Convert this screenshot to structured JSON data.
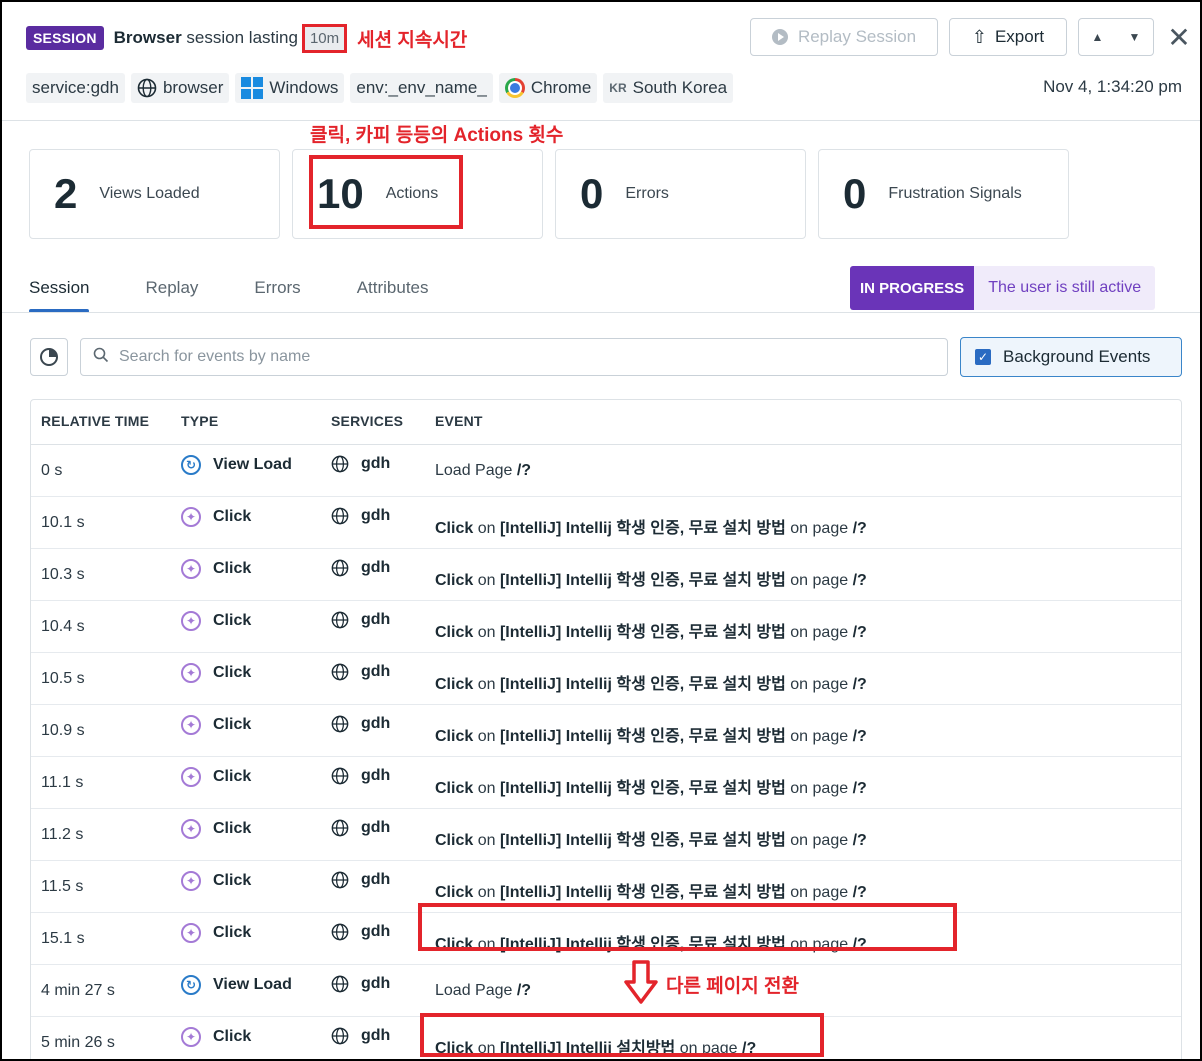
{
  "header": {
    "badge": "SESSION",
    "title_bold": "Browser",
    "title_rest": "session lasting",
    "duration": "10m",
    "annotation_duration": "세션 지속시간",
    "replay_label": "Replay Session",
    "export_label": "Export",
    "timestamp": "Nov 4, 1:34:20 pm",
    "tags": {
      "service": "service:gdh",
      "browser": "browser",
      "os": "Windows",
      "env": "env:_env_name_",
      "chrome": "Chrome",
      "country_code": "KR",
      "country": "South Korea"
    }
  },
  "summary": {
    "annotation": "클릭, 카피 등등의 Actions 횟수",
    "views": {
      "value": "2",
      "label": "Views Loaded"
    },
    "actions": {
      "value": "10",
      "label": "Actions"
    },
    "errors": {
      "value": "0",
      "label": "Errors"
    },
    "frustration": {
      "value": "0",
      "label": "Frustration Signals"
    }
  },
  "tabs": [
    "Session",
    "Replay",
    "Errors",
    "Attributes"
  ],
  "status": {
    "pill": "IN PROGRESS",
    "message": "The user is still active"
  },
  "search": {
    "placeholder": "Search for events by name"
  },
  "background_events": {
    "label": "Background Events",
    "checked": true
  },
  "table": {
    "columns": [
      "RELATIVE TIME",
      "TYPE",
      "SERVICES",
      "EVENT"
    ],
    "rows": [
      {
        "time": "0 s",
        "type": "View Load",
        "service": "gdh",
        "e1": "Load Page",
        "e2": " /?",
        "e3": "",
        "e4": ""
      },
      {
        "time": "10.1 s",
        "type": "Click",
        "service": "gdh",
        "e1": "Click",
        "e2": " on ",
        "e3": "[IntelliJ] Intellij 학생 인증, 무료 설치 방법",
        "e4": " on page /?"
      },
      {
        "time": "10.3 s",
        "type": "Click",
        "service": "gdh",
        "e1": "Click",
        "e2": " on ",
        "e3": "[IntelliJ] Intellij 학생 인증, 무료 설치 방법",
        "e4": " on page /?"
      },
      {
        "time": "10.4 s",
        "type": "Click",
        "service": "gdh",
        "e1": "Click",
        "e2": " on ",
        "e3": "[IntelliJ] Intellij 학생 인증, 무료 설치 방법",
        "e4": " on page /?"
      },
      {
        "time": "10.5 s",
        "type": "Click",
        "service": "gdh",
        "e1": "Click",
        "e2": " on ",
        "e3": "[IntelliJ] Intellij 학생 인증, 무료 설치 방법",
        "e4": " on page /?"
      },
      {
        "time": "10.9 s",
        "type": "Click",
        "service": "gdh",
        "e1": "Click",
        "e2": " on ",
        "e3": "[IntelliJ] Intellij 학생 인증, 무료 설치 방법",
        "e4": " on page /?"
      },
      {
        "time": "11.1 s",
        "type": "Click",
        "service": "gdh",
        "e1": "Click",
        "e2": " on ",
        "e3": "[IntelliJ] Intellij 학생 인증, 무료 설치 방법",
        "e4": " on page /?"
      },
      {
        "time": "11.2 s",
        "type": "Click",
        "service": "gdh",
        "e1": "Click",
        "e2": " on ",
        "e3": "[IntelliJ] Intellij 학생 인증, 무료 설치 방법",
        "e4": " on page /?"
      },
      {
        "time": "11.5 s",
        "type": "Click",
        "service": "gdh",
        "e1": "Click",
        "e2": " on ",
        "e3": "[IntelliJ] Intellij 학생 인증, 무료 설치 방법",
        "e4": " on page /?"
      },
      {
        "time": "15.1 s",
        "type": "Click",
        "service": "gdh",
        "e1": "Click",
        "e2": " on ",
        "e3": "[IntelliJ] Intellij 학생 인증, 무료 설치 방법",
        "e4": " on page /?"
      },
      {
        "time": "4 min 27 s",
        "type": "View Load",
        "service": "gdh",
        "e1": "Load Page",
        "e2": " /?",
        "e3": "",
        "e4": ""
      },
      {
        "time": "5 min 26 s",
        "type": "Click",
        "service": "gdh",
        "e1": "Click",
        "e2": " on ",
        "e3": "[IntelliJ] Intellij 설치방법",
        "e4": " on page /?"
      }
    ]
  },
  "annotation_page_change": "다른 페이지 전환",
  "colors": {
    "session_badge": "#5a2ca0",
    "annotation_red": "#e3242b",
    "accent_blue": "#2a6bc2",
    "status_purple": "#6a34b8"
  }
}
